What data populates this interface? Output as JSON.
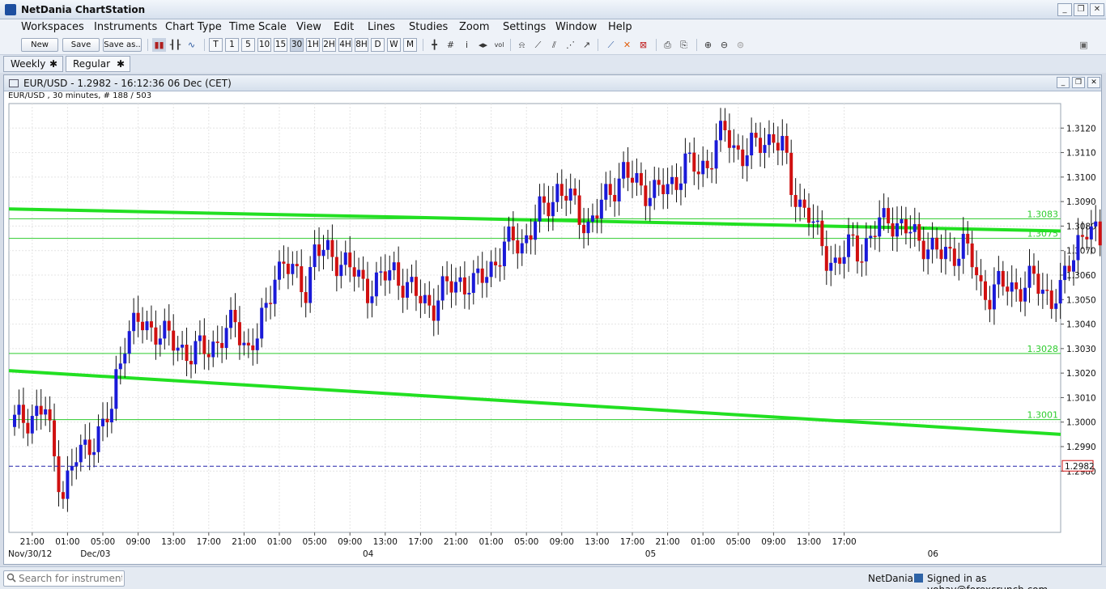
{
  "app": {
    "title": "NetDania ChartStation"
  },
  "menu": [
    "Workspaces",
    "Instruments",
    "Chart Type",
    "Time Scale",
    "View",
    "Edit",
    "Lines",
    "Studies",
    "Zoom",
    "Settings",
    "Window",
    "Help"
  ],
  "toolbar": {
    "new_label": "New",
    "save_label": "Save",
    "saveas_label": "Save as..",
    "timeframes": [
      "T",
      "1",
      "5",
      "10",
      "15",
      "30",
      "1H",
      "2H",
      "4H",
      "8H",
      "D",
      "W",
      "M"
    ],
    "active_timeframe": "30"
  },
  "tabs": [
    {
      "label": "Weekly"
    },
    {
      "label": "Regular"
    }
  ],
  "chart_window": {
    "title": "EUR/USD - 1.2982 - 16:12:36  06 Dec (CET)",
    "subtitle": "EUR/USD , 30 minutes, # 188 / 503"
  },
  "chart_data": {
    "type": "candlestick",
    "instrument": "EUR/USD",
    "interval": "30 minutes",
    "ylim": [
      1.2955,
      1.313
    ],
    "y_ticks": [
      "1.3120",
      "1.3110",
      "1.3100",
      "1.3090",
      "1.3080",
      "1.3070",
      "1.3060",
      "1.3050",
      "1.3040",
      "1.3030",
      "1.3020",
      "1.3010",
      "1.3000",
      "1.2990",
      "1.2980"
    ],
    "x_tick_labels": [
      "21:00",
      "01:00",
      "05:00",
      "09:00",
      "13:00",
      "17:00",
      "21:00",
      "01:00",
      "05:00",
      "09:00",
      "13:00",
      "17:00",
      "21:00",
      "01:00",
      "05:00",
      "09:00",
      "13:00",
      "17:00",
      "21:00",
      "01:00",
      "05:00",
      "09:00",
      "13:00",
      "17:00"
    ],
    "date_labels": [
      "Nov/30/12",
      "Dec/03",
      "04",
      "05",
      "06"
    ],
    "horizontal_levels": [
      {
        "label": "1.3083",
        "value": 1.3083
      },
      {
        "label": "1.3075",
        "value": 1.3075
      },
      {
        "label": "1.3028",
        "value": 1.3028
      },
      {
        "label": "1.3001",
        "value": 1.3001
      }
    ],
    "trend_lines": [
      {
        "name": "upper",
        "y_start": 1.3087,
        "y_end": 1.3078
      },
      {
        "name": "lower",
        "y_start": 1.3021,
        "y_end": 1.2995
      }
    ],
    "current_price": {
      "label": "1.2982",
      "value": 1.2982
    },
    "anchors": [
      [
        0,
        1.3
      ],
      [
        4,
        1.3003
      ],
      [
        7,
        1.3005
      ],
      [
        9,
        1.2985
      ],
      [
        11,
        1.2972
      ],
      [
        14,
        1.2985
      ],
      [
        17,
        1.2992
      ],
      [
        20,
        1.2997
      ],
      [
        22,
        1.3005
      ],
      [
        23,
        1.3018
      ],
      [
        25,
        1.3035
      ],
      [
        28,
        1.304
      ],
      [
        32,
        1.3038
      ],
      [
        36,
        1.3032
      ],
      [
        40,
        1.3028
      ],
      [
        44,
        1.303
      ],
      [
        47,
        1.3035
      ],
      [
        50,
        1.304
      ],
      [
        53,
        1.303
      ],
      [
        55,
        1.3035
      ],
      [
        57,
        1.3045
      ],
      [
        59,
        1.3062
      ],
      [
        61,
        1.3065
      ],
      [
        64,
        1.3058
      ],
      [
        66,
        1.3055
      ],
      [
        68,
        1.307
      ],
      [
        72,
        1.3068
      ],
      [
        75,
        1.3065
      ],
      [
        78,
        1.3058
      ],
      [
        80,
        1.3055
      ],
      [
        83,
        1.3058
      ],
      [
        86,
        1.3062
      ],
      [
        89,
        1.3055
      ],
      [
        92,
        1.305
      ],
      [
        95,
        1.3048
      ],
      [
        98,
        1.3055
      ],
      [
        101,
        1.3058
      ],
      [
        104,
        1.3055
      ],
      [
        107,
        1.3062
      ],
      [
        110,
        1.3068
      ],
      [
        113,
        1.3075
      ],
      [
        115,
        1.3073
      ],
      [
        117,
        1.3078
      ],
      [
        119,
        1.3085
      ],
      [
        121,
        1.309
      ],
      [
        123,
        1.3095
      ],
      [
        125,
        1.3092
      ],
      [
        127,
        1.3088
      ],
      [
        130,
        1.308
      ],
      [
        132,
        1.3085
      ],
      [
        135,
        1.3095
      ],
      [
        138,
        1.3102
      ],
      [
        140,
        1.3098
      ],
      [
        142,
        1.3096
      ],
      [
        145,
        1.3094
      ],
      [
        148,
        1.3095
      ],
      [
        150,
        1.31
      ],
      [
        152,
        1.3106
      ],
      [
        155,
        1.3102
      ],
      [
        157,
        1.3106
      ],
      [
        159,
        1.3114
      ],
      [
        161,
        1.3118
      ],
      [
        163,
        1.3112
      ],
      [
        165,
        1.311
      ],
      [
        168,
        1.3112
      ],
      [
        170,
        1.3115
      ],
      [
        172,
        1.3117
      ],
      [
        174,
        1.3112
      ],
      [
        176,
        1.3095
      ],
      [
        178,
        1.309
      ],
      [
        180,
        1.3085
      ],
      [
        182,
        1.3075
      ],
      [
        184,
        1.3068
      ],
      [
        186,
        1.3065
      ],
      [
        188,
        1.3068
      ],
      [
        190,
        1.3073
      ],
      [
        192,
        1.307
      ],
      [
        194,
        1.3075
      ],
      [
        196,
        1.308
      ],
      [
        198,
        1.3085
      ],
      [
        200,
        1.308
      ],
      [
        202,
        1.3078
      ],
      [
        204,
        1.3076
      ],
      [
        206,
        1.3074
      ],
      [
        208,
        1.307
      ],
      [
        210,
        1.3068
      ],
      [
        213,
        1.307
      ],
      [
        215,
        1.3072
      ],
      [
        217,
        1.3065
      ],
      [
        219,
        1.3055
      ],
      [
        221,
        1.3052
      ],
      [
        223,
        1.3055
      ],
      [
        225,
        1.3056
      ],
      [
        227,
        1.3055
      ],
      [
        229,
        1.3055
      ],
      [
        231,
        1.3058
      ],
      [
        233,
        1.3055
      ],
      [
        235,
        1.305
      ],
      [
        237,
        1.3052
      ],
      [
        239,
        1.3065
      ],
      [
        241,
        1.3075
      ],
      [
        243,
        1.3078
      ],
      [
        245,
        1.3075
      ],
      [
        247,
        1.3072
      ],
      [
        249,
        1.3068
      ],
      [
        251,
        1.3075
      ],
      [
        252,
        1.3078
      ],
      [
        253,
        1.307
      ],
      [
        254,
        1.303
      ],
      [
        255,
        1.3038
      ],
      [
        256,
        1.3005
      ],
      [
        257,
        1.2982
      ]
    ]
  },
  "status": {
    "search_placeholder": "Search for instrument",
    "brand": "NetDania",
    "signed_in": "Signed in as yohay@forexcrunch.com"
  }
}
